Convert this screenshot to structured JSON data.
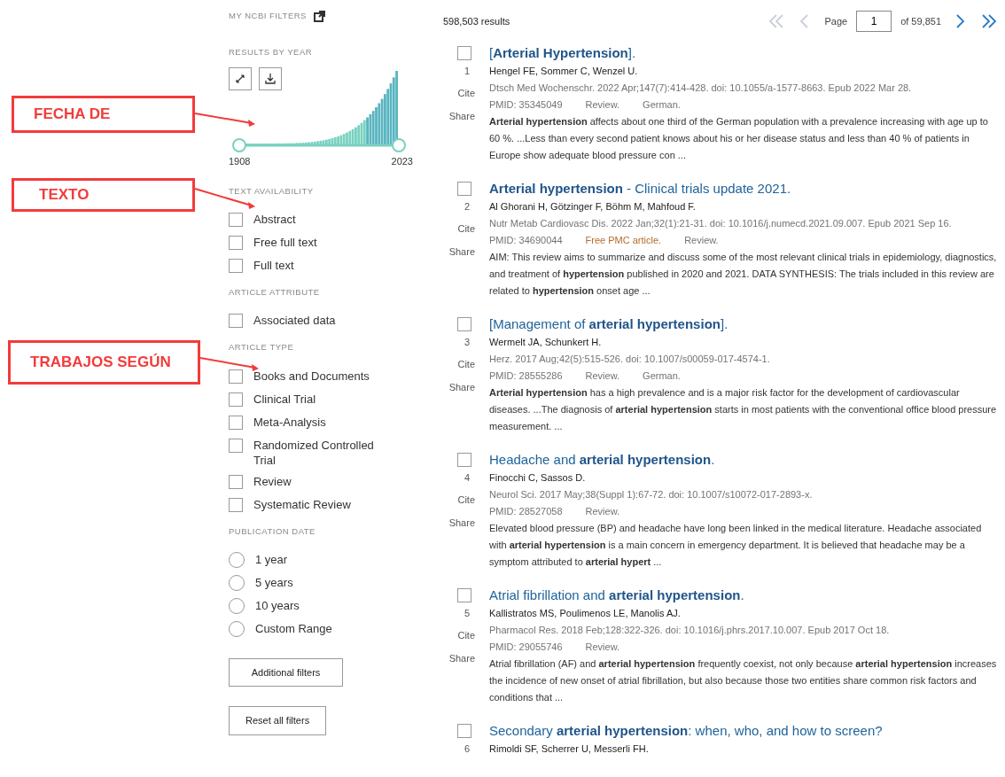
{
  "annotations": [
    {
      "label": "FECHA DE"
    },
    {
      "label": "TEXTO"
    },
    {
      "label": "TRABAJOS SEGÚN"
    }
  ],
  "sidebar": {
    "my_filters": "MY NCBI FILTERS",
    "results_by_year": {
      "heading": "RESULTS BY YEAR",
      "start_year": "1908",
      "end_year": "2023"
    },
    "groups": [
      {
        "heading": "TEXT AVAILABILITY",
        "kind": "checkbox",
        "options": [
          {
            "label": "Abstract",
            "checked": false
          },
          {
            "label": "Free full text",
            "checked": false
          },
          {
            "label": "Full text",
            "checked": false
          }
        ]
      },
      {
        "heading": "ARTICLE ATTRIBUTE",
        "kind": "checkbox",
        "options": [
          {
            "label": "Associated data",
            "checked": false
          }
        ]
      },
      {
        "heading": "ARTICLE TYPE",
        "kind": "checkbox",
        "options": [
          {
            "label": "Books and Documents",
            "checked": false
          },
          {
            "label": "Clinical Trial",
            "checked": false
          },
          {
            "label": "Meta-Analysis",
            "checked": false
          },
          {
            "label": "Randomized Controlled Trial",
            "checked": false
          },
          {
            "label": "Review",
            "checked": false
          },
          {
            "label": "Systematic Review",
            "checked": false
          }
        ]
      },
      {
        "heading": "PUBLICATION DATE",
        "kind": "radio",
        "options": [
          {
            "label": "1 year",
            "selected": false
          },
          {
            "label": "5 years",
            "selected": false
          },
          {
            "label": "10 years",
            "selected": false
          },
          {
            "label": "Custom Range",
            "selected": false
          }
        ]
      }
    ],
    "buttons": [
      "Additional filters",
      "Reset all filters"
    ]
  },
  "results_count": "598,503 results",
  "pagination": {
    "first_disabled": true,
    "previous_disabled": true,
    "page_label": "Page",
    "page": "1",
    "of_label": "of 59,851",
    "next_disabled": false,
    "last_disabled": false
  },
  "results": [
    {
      "number": "1",
      "checked": false,
      "title": "[**Arterial Hypertension**].",
      "authors": "Hengel FE, Sommer C, Wenzel U.",
      "citation": "Dtsch Med Wochenschr. 2022 Apr;147(7):414-428. doi: 10.1055/a-1577-8663. Epub 2022 Mar 28.",
      "pmid": "PMID: 35345049",
      "tags": [
        {
          "text": "Review.",
          "kind": "plain"
        },
        {
          "text": "German.",
          "kind": "plain"
        }
      ],
      "snippet": "**Arterial hypertension** affects about one third of the German population with a prevalence increasing with age up to 60 %. ...Less than every second patient knows about his or her disease status and less than 40 % of patients in Europe show adequate blood pressure con ...",
      "cite": "Cite",
      "share": "Share"
    },
    {
      "number": "2",
      "checked": false,
      "title": "**Arterial hypertension** - Clinical trials update 2021.",
      "authors": "Al Ghorani H, Götzinger F, Böhm M, Mahfoud F.",
      "citation": "Nutr Metab Cardiovasc Dis. 2022 Jan;32(1):21-31. doi: 10.1016/j.numecd.2021.09.007. Epub 2021 Sep 16.",
      "pmid": "PMID: 34690044",
      "tags": [
        {
          "text": "Free PMC article.",
          "kind": "free"
        },
        {
          "text": "Review.",
          "kind": "plain"
        }
      ],
      "snippet": "AIM: This review aims to summarize and discuss some of the most relevant clinical trials in epidemiology, diagnostics, and treatment of **hypertension** published in 2020 and 2021. DATA SYNTHESIS: The trials included in this review are related to **hypertension** onset age ...",
      "cite": "Cite",
      "share": "Share"
    },
    {
      "number": "3",
      "checked": false,
      "title": "[Management of **arterial hypertension**].",
      "authors": "Wermelt JA, Schunkert H.",
      "citation": "Herz. 2017 Aug;42(5):515-526. doi: 10.1007/s00059-017-4574-1.",
      "pmid": "PMID: 28555286",
      "tags": [
        {
          "text": "Review.",
          "kind": "plain"
        },
        {
          "text": "German.",
          "kind": "plain"
        }
      ],
      "snippet": "**Arterial hypertension** has a high prevalence and is a major risk factor for the development of cardiovascular diseases. ...The diagnosis of **arterial hypertension** starts in most patients with the conventional office blood pressure measurement. ...",
      "cite": "Cite",
      "share": "Share"
    },
    {
      "number": "4",
      "checked": false,
      "title": "Headache and **arterial hypertension**.",
      "authors": "Finocchi C, Sassos D.",
      "citation": "Neurol Sci. 2017 May;38(Suppl 1):67-72. doi: 10.1007/s10072-017-2893-x.",
      "pmid": "PMID: 28527058",
      "tags": [
        {
          "text": "Review.",
          "kind": "plain"
        }
      ],
      "snippet": "Elevated blood pressure (BP) and headache have long been linked in the medical literature. Headache associated with **arterial hypertension** is a main concern in emergency department. It is believed that headache may be a symptom attributed to **arterial hypert** ...",
      "cite": "Cite",
      "share": "Share"
    },
    {
      "number": "5",
      "checked": false,
      "title": "Atrial fibrillation and **arterial hypertension**.",
      "authors": "Kallistratos MS, Poulimenos LE, Manolis AJ.",
      "citation": "Pharmacol Res. 2018 Feb;128:322-326. doi: 10.1016/j.phrs.2017.10.007. Epub 2017 Oct 18.",
      "pmid": "PMID: 29055746",
      "tags": [
        {
          "text": "Review.",
          "kind": "plain"
        }
      ],
      "snippet": "Atrial fibrillation (AF) and **arterial hypertension** frequently coexist, not only because **arterial hypertension** increases the incidence of new onset of atrial fibrillation, but also because those two entities share common risk factors and conditions that ...",
      "cite": "Cite",
      "share": "Share"
    },
    {
      "number": "6",
      "checked": false,
      "title": "Secondary **arterial hypertension**: when, who, and how to screen?",
      "authors": "Rimoldi SF, Scherrer U, Messerli FH."
    }
  ]
}
